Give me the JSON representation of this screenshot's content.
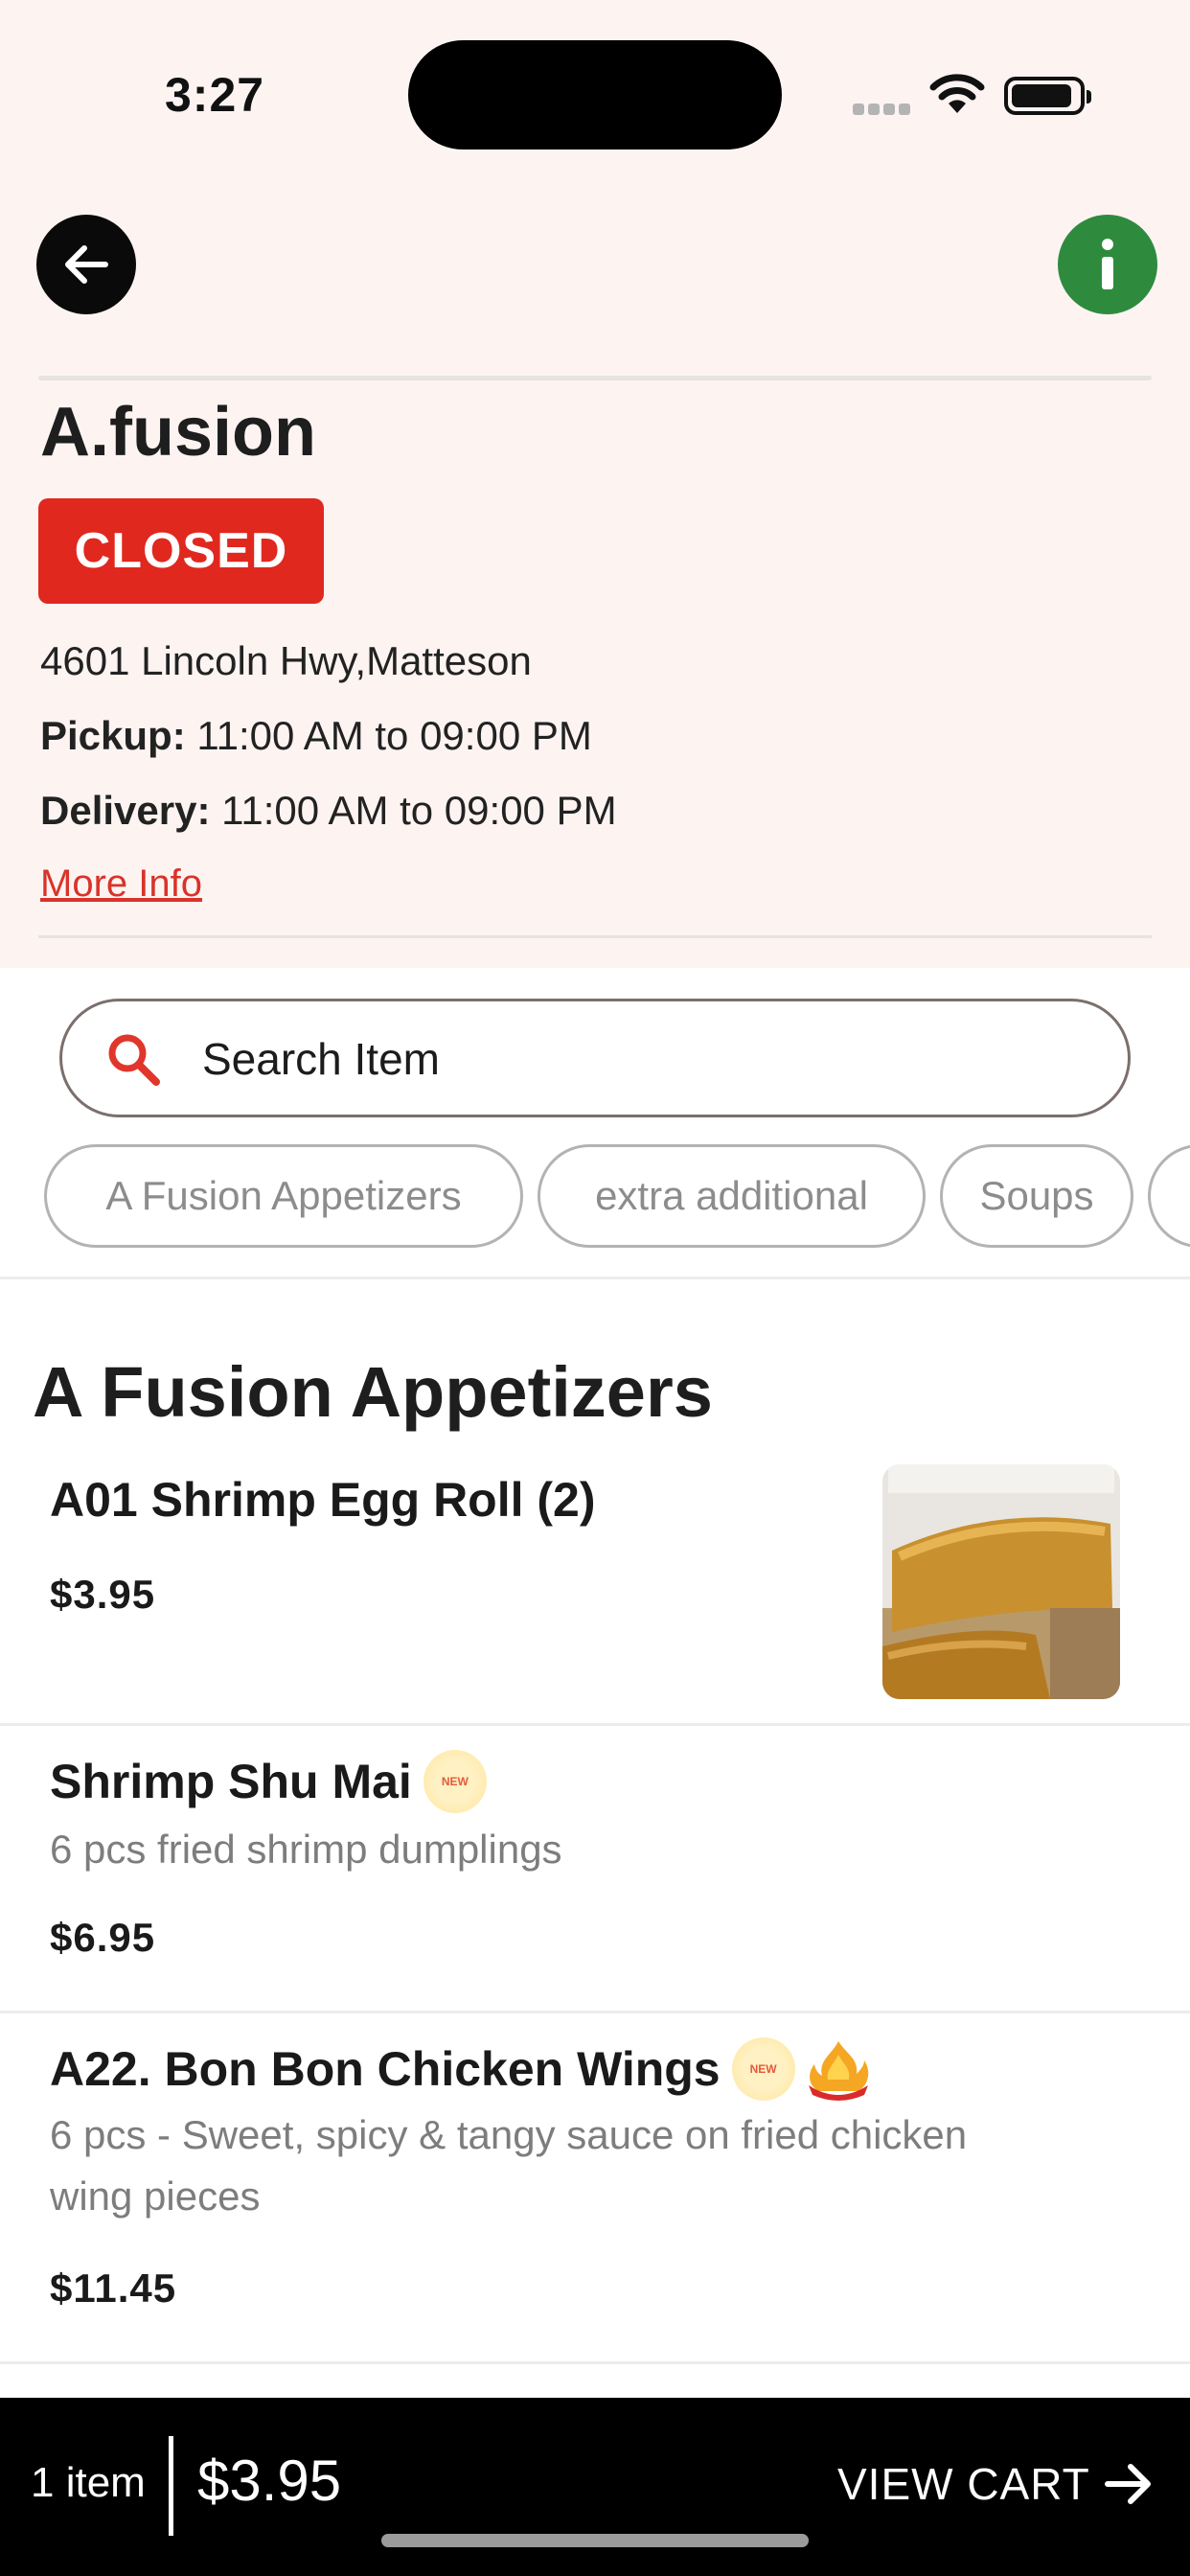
{
  "status": {
    "time": "3:27"
  },
  "restaurant": {
    "name": "A.fusion",
    "status_badge": "CLOSED",
    "address": "4601 Lincoln Hwy,Matteson",
    "pickup_label": "Pickup:",
    "pickup_hours": "11:00 AM to 09:00 PM",
    "delivery_label": "Delivery:",
    "delivery_hours": "11:00 AM to 09:00 PM",
    "more_info": "More Info"
  },
  "search": {
    "placeholder": "Search Item"
  },
  "categories": [
    "A Fusion Appetizers",
    "extra additional",
    "Soups",
    ""
  ],
  "section": {
    "title": "A Fusion Appetizers"
  },
  "items": [
    {
      "name": "A01 Shrimp Egg Roll (2)",
      "description": "",
      "price": "$3.95"
    },
    {
      "name": "Shrimp Shu Mai",
      "description": "6 pcs fried shrimp dumplings",
      "price": "$6.95",
      "badge_new": "NEW"
    },
    {
      "name": "A22. Bon Bon Chicken Wings",
      "description": "6 pcs - Sweet, spicy & tangy sauce on fried chicken wing pieces",
      "price": "$11.45",
      "badge_new": "NEW"
    }
  ],
  "cart": {
    "count": "1 item",
    "total": "$3.95",
    "action": "VIEW CART"
  },
  "colors": {
    "accent_red": "#e0281f",
    "info_green": "#2e8b3e",
    "header_bg": "#fdf4f2"
  },
  "icons": [
    "arrow-left-icon",
    "info-icon",
    "search-icon",
    "new-badge-icon",
    "spicy-fire-icon",
    "arrow-right-icon"
  ]
}
